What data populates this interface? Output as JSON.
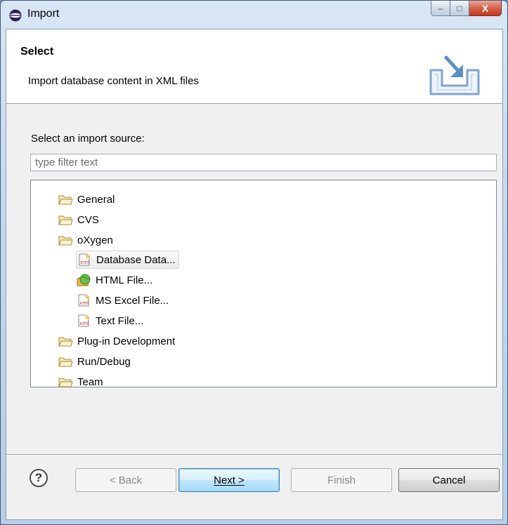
{
  "window": {
    "title": "Import",
    "minimize_glyph": "–",
    "maximize_glyph": "□",
    "close_glyph": "X"
  },
  "header": {
    "title": "Select",
    "description": "Import database content in XML files",
    "image_icon": "import-wizard-banner-icon"
  },
  "source": {
    "label": "Select an import source:",
    "filter_value": "",
    "filter_placeholder": "type filter text"
  },
  "tree": {
    "items": [
      {
        "label": "General",
        "icon": "folder-icon",
        "level": 0
      },
      {
        "label": "CVS",
        "icon": "folder-icon",
        "level": 0
      },
      {
        "label": "oXygen",
        "icon": "folder-open-icon",
        "level": 0
      },
      {
        "label": "Database Data...",
        "icon": "xml-file-icon",
        "level": 1,
        "selected": true
      },
      {
        "label": "HTML File...",
        "icon": "html-globe-icon",
        "level": 1
      },
      {
        "label": "MS Excel File...",
        "icon": "xml-file-icon",
        "level": 1
      },
      {
        "label": "Text File...",
        "icon": "xml-file-icon",
        "level": 1
      },
      {
        "label": "Plug-in Development",
        "icon": "folder-icon",
        "level": 0
      },
      {
        "label": "Run/Debug",
        "icon": "folder-icon",
        "level": 0
      },
      {
        "label": "Team",
        "icon": "folder-icon",
        "level": 0
      }
    ]
  },
  "buttons": {
    "help_glyph": "?",
    "back_label": "< Back",
    "next_label": "Next >",
    "finish_label": "Finish",
    "cancel_label": "Cancel"
  },
  "colors": {
    "title_bar": "#c4d6ec",
    "client_bg": "#f0f0f0",
    "default_button": "#bee6fd",
    "close_button": "#c4371f"
  }
}
